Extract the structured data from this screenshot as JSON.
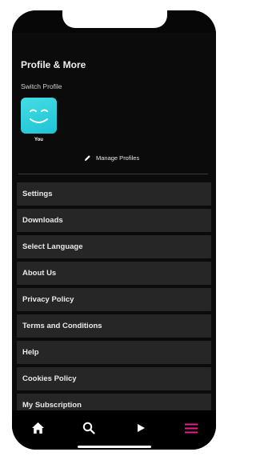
{
  "header": {
    "title": "Profile & More",
    "switch_label": "Switch Profile"
  },
  "profile": {
    "name": "You",
    "avatar_color": "#2ccfe0"
  },
  "manage": {
    "label": "Manage Profiles",
    "icon": "pencil-icon"
  },
  "menu": {
    "items": [
      {
        "label": "Settings"
      },
      {
        "label": "Downloads"
      },
      {
        "label": "Select Language"
      },
      {
        "label": "About Us"
      },
      {
        "label": "Privacy Policy"
      },
      {
        "label": "Terms and Conditions"
      },
      {
        "label": "Help"
      },
      {
        "label": "Cookies Policy"
      },
      {
        "label": "My Subscription"
      }
    ]
  },
  "tabbar": {
    "tabs": [
      {
        "icon": "home-icon",
        "active": false
      },
      {
        "icon": "search-icon",
        "active": false
      },
      {
        "icon": "play-icon",
        "active": false
      },
      {
        "icon": "menu-icon",
        "active": true
      }
    ],
    "active_color": "#e91e8c"
  }
}
